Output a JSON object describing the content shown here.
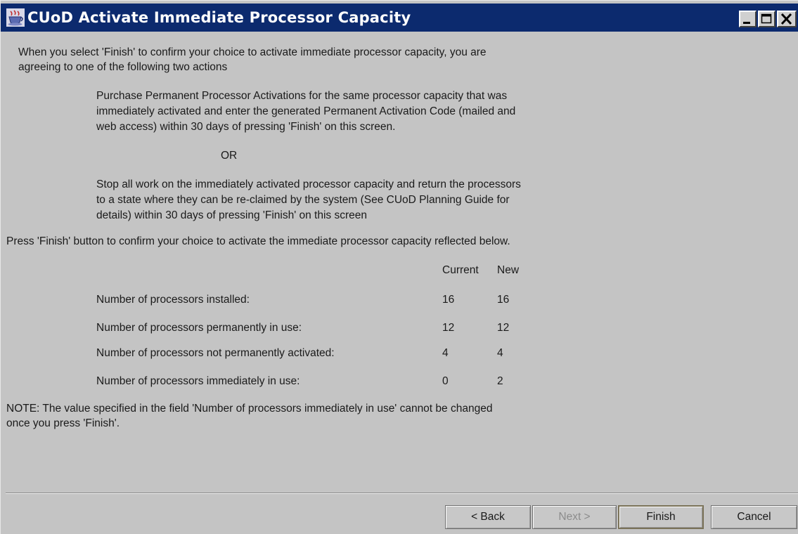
{
  "window": {
    "title": "CUoD Activate Immediate Processor Capacity",
    "icon": "java-cup-icon",
    "controls": [
      "minimize-icon",
      "maximize-icon",
      "close-icon"
    ]
  },
  "intro": {
    "line1": "When you select 'Finish' to confirm your choice to activate immediate processor capacity, you are",
    "line2": "agreeing to one of the following two actions"
  },
  "option1": {
    "line1": "Purchase Permanent Processor Activations for the same processor capacity that was",
    "line2": "immediately activated and enter the generated Permanent Activation Code (mailed and",
    "line3": "web access) within 30 days of pressing 'Finish' on this screen."
  },
  "or_label": "OR",
  "option2": {
    "line1": "Stop all work on the immediately activated processor capacity and return the processors",
    "line2": "to a state where they can be re-claimed by the system (See CUoD Planning Guide for",
    "line3": "details) within 30 days of pressing 'Finish' on this screen"
  },
  "press_finish": "Press 'Finish' button to confirm your choice to activate the immediate processor capacity reflected below.",
  "table": {
    "headers": {
      "current": "Current",
      "new": "New"
    },
    "rows": [
      {
        "label": "Number of processors installed:",
        "current": "16",
        "new": "16"
      },
      {
        "label": "Number of processors permanently in use:",
        "current": "12",
        "new": "12"
      },
      {
        "label": "Number of processors not permanently activated:",
        "current": "4",
        "new": "4"
      },
      {
        "label": "Number of processors immediately in use:",
        "current": "0",
        "new": "2"
      }
    ]
  },
  "note": {
    "line1": "NOTE: The value specified in the field  'Number of processors immediately in use' cannot be changed",
    "line2": "once  you press 'Finish'."
  },
  "buttons": {
    "back": "< Back",
    "next": "Next >",
    "finish": "Finish",
    "cancel": "Cancel"
  }
}
